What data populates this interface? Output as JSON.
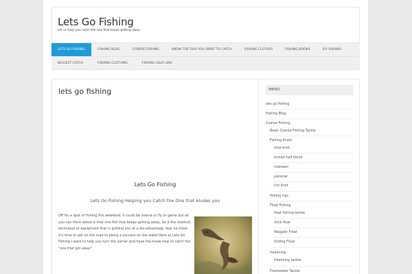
{
  "site": {
    "title": "Lets Go Fishing",
    "description": "Let us help you catch the one that keeps getting away"
  },
  "nav": {
    "row1": [
      "LETS GO FISHING",
      "FISHING BLOG",
      "COARSE FISHING",
      "KNOW THE FISH YOU WANT TO CATCH",
      "FISHING CLOTHES",
      "FISHING BOOKS",
      "FLY FISHING"
    ],
    "row2": [
      "BIGGEST CATCH",
      "FISHING CLOTHING",
      "FISHING HELP LINE"
    ]
  },
  "post": {
    "title": "lets go fishing",
    "heading": "Lets Go Fishing",
    "subheading": "Lets Go Fishing Helping you Catch the One that eludes you",
    "body": "Off for a spot of fishing this weekend, it could be coarse or fly or game but all you can think about is that one fish that keeps getting away, be it the method, technique or equipment that is putting you at a dis-advantage, fear no more it's time to get on the road to being a success on the water.Here at Lets Go Fishing I want to help you turn the corner and have the know-how to catch the \"one that got away\"."
  },
  "sidebar": {
    "heading": "MENU",
    "items": [
      {
        "label": "lets go fishing",
        "level": 0
      },
      {
        "label": "Fishing Blog",
        "level": 0
      },
      {
        "label": "Coarse Fishing",
        "level": 0
      },
      {
        "label": "Basic Coarse Fishing Tackle",
        "level": 1
      },
      {
        "label": "Fishing Knots",
        "level": 1
      },
      {
        "label": "stop knot",
        "level": 2
      },
      {
        "label": "locked half blood",
        "level": 2
      },
      {
        "label": "mahseer",
        "level": 2
      },
      {
        "label": "palomar",
        "level": 2
      },
      {
        "label": "Uni Knot",
        "level": 2
      },
      {
        "label": "fishing rigs",
        "level": 1
      },
      {
        "label": "Float Fishing",
        "level": 1
      },
      {
        "label": "float fishing tackle",
        "level": 2
      },
      {
        "label": "stick float",
        "level": 2
      },
      {
        "label": "Waggler Float",
        "level": 2
      },
      {
        "label": "Sliding Float",
        "level": 2
      },
      {
        "label": "freelining",
        "level": 1
      },
      {
        "label": "freelining tackle",
        "level": 2
      },
      {
        "label": "Freshwater Tackle",
        "level": 1
      }
    ]
  },
  "colors": {
    "accent": "#1e9bd8",
    "background": "#e9e9e9"
  }
}
